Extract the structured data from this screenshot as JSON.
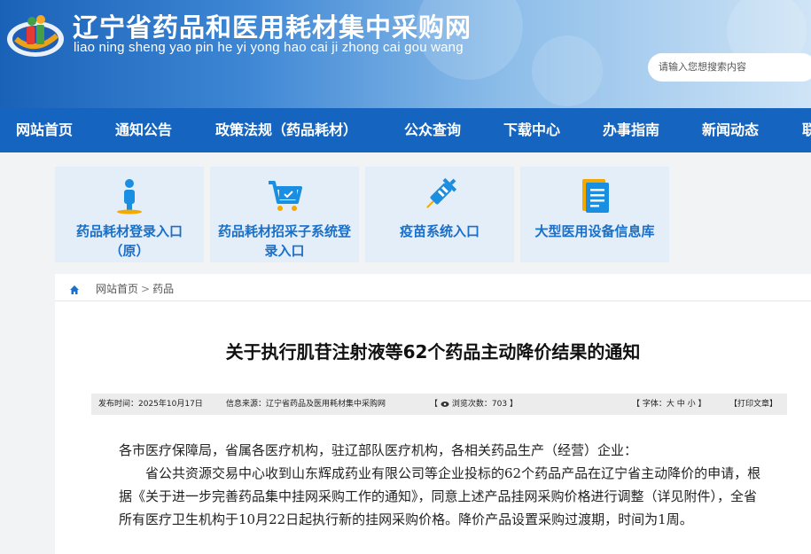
{
  "header": {
    "title": "辽宁省药品和医用耗材集中采购网",
    "pinyin": "liao ning sheng yao pin he yi yong hao cai ji zhong cai gou wang",
    "search_placeholder": "请输入您想搜索内容"
  },
  "nav": {
    "items": [
      {
        "label": "网站首页"
      },
      {
        "label": "通知公告"
      },
      {
        "label": "政策法规（药品耗材）"
      },
      {
        "label": "公众查询"
      },
      {
        "label": "下载中心"
      },
      {
        "label": "办事指南"
      },
      {
        "label": "新闻动态"
      },
      {
        "label": "联"
      }
    ]
  },
  "entries": [
    {
      "label": "药品耗材登录入口（原）",
      "icon": "person-icon",
      "color": "#1a8ee0"
    },
    {
      "label": "药品耗材招采子系统登录入口",
      "icon": "cart-icon",
      "color": "#1a8ee0"
    },
    {
      "label": "疫苗系统入口",
      "icon": "syringe-icon",
      "color": "#1a8ee0"
    },
    {
      "label": "大型医用设备信息库",
      "icon": "document-icon",
      "color": "#f2a900"
    }
  ],
  "breadcrumb": {
    "home_label": "网站首页",
    "separator": ">",
    "current": "药品"
  },
  "article": {
    "title": "关于执行肌苷注射液等62个药品主动降价结果的通知",
    "meta": {
      "publish_time": "发布时间：2025年10月17日",
      "source": "信息来源：辽宁省药品及医用耗材集中采购网",
      "views": "浏览次数：703 】",
      "font_size": "【 字体：大 中 小 】",
      "print": "【打印文章】"
    },
    "paragraphs": [
      "各市医疗保障局，省属各医疗机构，驻辽部队医疗机构，各相关药品生产（经营）企业：",
      "省公共资源交易中心收到山东辉成药业有限公司等企业投标的62个药品产品在辽宁省主动降价的申请，根据《关于进一步完善药品集中挂网采购工作的通知》，同意上述产品挂网采购价格进行调整（详见附件），全省所有医疗卫生机构于10月22日起执行新的挂网采购价格。降价产品设置采购过渡期，时间为1周。"
    ]
  },
  "colors": {
    "nav_bg": "#1565c0",
    "card_bg": "#e3eef8",
    "card_text": "#1a6fc9"
  }
}
